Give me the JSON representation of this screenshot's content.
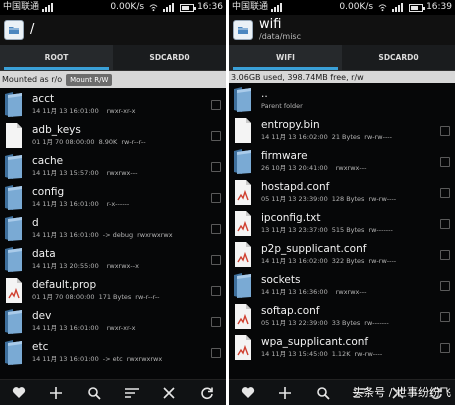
{
  "left": {
    "status": {
      "carrier": "中国联通",
      "speed": "0.00K/s",
      "time": "16:36"
    },
    "title": {
      "path": "/"
    },
    "tabs": [
      {
        "label": "ROOT",
        "active": true
      },
      {
        "label": "SDCARD0",
        "active": false
      }
    ],
    "mount": {
      "label": "Mounted as r/o",
      "button": "Mount R/W"
    },
    "files": [
      {
        "name": "acct",
        "date": "14 11月 13 16:01:00",
        "detail": "",
        "perms": "rwxr-xr-x",
        "icon": "folder-icon"
      },
      {
        "name": "adb_keys",
        "date": "01 1月 70 08:00:00",
        "detail": "8.90K",
        "perms": "rw-r--r--",
        "icon": "file-icon"
      },
      {
        "name": "cache",
        "date": "14 11月 13 15:57:00",
        "detail": "",
        "perms": "rwxrwx---",
        "icon": "folder-icon"
      },
      {
        "name": "config",
        "date": "14 11月 13 16:01:00",
        "detail": "",
        "perms": "r-x------",
        "icon": "folder-icon"
      },
      {
        "name": "d",
        "date": "14 11月 13 16:01:00",
        "detail": "-> debug",
        "perms": "rwxrwxrwx",
        "icon": "folder-icon"
      },
      {
        "name": "data",
        "date": "14 11月 13 20:55:00",
        "detail": "",
        "perms": "rwxrwx--x",
        "icon": "folder-icon"
      },
      {
        "name": "default.prop",
        "date": "01 1月 70 08:00:00",
        "detail": "171 Bytes",
        "perms": "rw-r--r--",
        "icon": "doc-icon"
      },
      {
        "name": "dev",
        "date": "14 11月 13 16:01:00",
        "detail": "",
        "perms": "rwxr-xr-x",
        "icon": "folder-icon"
      },
      {
        "name": "etc",
        "date": "14 11月 13 16:01:00",
        "detail": "-> etc",
        "perms": "rwxrwxrwx",
        "icon": "folder-icon"
      }
    ]
  },
  "right": {
    "status": {
      "carrier": "中国联通",
      "speed": "0.00K/s",
      "time": "16:39"
    },
    "title": {
      "path": "wifi",
      "subpath": "/data/misc"
    },
    "tabs": [
      {
        "label": "WIFI",
        "active": true
      },
      {
        "label": "SDCARD0",
        "active": false
      }
    ],
    "storage": "3.06GB used, 398.74MB free, r/w",
    "parent": {
      "name": "..",
      "label": "Parent folder"
    },
    "files": [
      {
        "name": "entropy.bin",
        "date": "14 11月 13 16:02:00",
        "detail": "21 Bytes",
        "perms": "rw-rw----",
        "icon": "file-icon"
      },
      {
        "name": "firmware",
        "date": "26 10月 13 20:41:00",
        "detail": "",
        "perms": "rwxrwx---",
        "icon": "folder-icon"
      },
      {
        "name": "hostapd.conf",
        "date": "05 11月 13 23:39:00",
        "detail": "128 Bytes",
        "perms": "rw-rw----",
        "icon": "doc-icon"
      },
      {
        "name": "ipconfig.txt",
        "date": "13 11月 13 23:37:00",
        "detail": "515 Bytes",
        "perms": "rw-------",
        "icon": "doc-icon"
      },
      {
        "name": "p2p_supplicant.conf",
        "date": "14 11月 13 16:02:00",
        "detail": "322 Bytes",
        "perms": "rw-rw----",
        "icon": "doc-icon"
      },
      {
        "name": "sockets",
        "date": "14 11月 13 16:36:00",
        "detail": "",
        "perms": "rwxrwx---",
        "icon": "folder-icon"
      },
      {
        "name": "softap.conf",
        "date": "05 11月 13 22:39:00",
        "detail": "33 Bytes",
        "perms": "rw-------",
        "icon": "doc-icon"
      },
      {
        "name": "wpa_supplicant.conf",
        "date": "14 11月 13 15:45:00",
        "detail": "1.12K",
        "perms": "rw-rw----",
        "icon": "doc-icon"
      }
    ]
  },
  "bottom_actions": [
    "heart-icon",
    "plus-icon",
    "search-icon",
    "sort-icon",
    "close-icon",
    "refresh-icon"
  ],
  "watermark": "头条号 / 世事纷纷飞",
  "colors": {
    "accent": "#3aa0d8",
    "folder": "#6f9fca",
    "background": "#060708"
  }
}
